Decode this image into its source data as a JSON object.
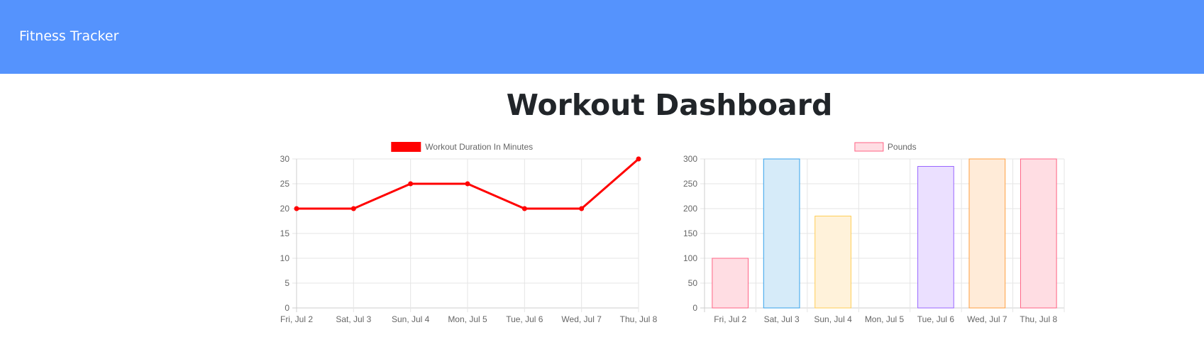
{
  "navbar": {
    "brand": "Fitness Tracker"
  },
  "page": {
    "title": "Workout Dashboard"
  },
  "chart_data": [
    {
      "type": "line",
      "categories": [
        "Fri, Jul 2",
        "Sat, Jul 3",
        "Sun, Jul 4",
        "Mon, Jul 5",
        "Tue, Jul 6",
        "Wed, Jul 7",
        "Thu, Jul 8"
      ],
      "series": [
        {
          "name": "Workout Duration In Minutes",
          "values": [
            20,
            20,
            25,
            25,
            20,
            20,
            30
          ],
          "color": "#ff0000"
        }
      ],
      "yticks": [
        0,
        5,
        10,
        15,
        20,
        25,
        30
      ],
      "ylim": [
        0,
        30
      ],
      "grid": true,
      "legend": "top-center"
    },
    {
      "type": "bar",
      "categories": [
        "Fri, Jul 2",
        "Sat, Jul 3",
        "Sun, Jul 4",
        "Mon, Jul 5",
        "Tue, Jul 6",
        "Wed, Jul 7",
        "Thu, Jul 8"
      ],
      "series": [
        {
          "name": "Pounds",
          "values": [
            100,
            300,
            185,
            0,
            285,
            300,
            300
          ]
        }
      ],
      "bar_fills": [
        "#ffdde3",
        "#d6ebf9",
        "#fff2da",
        "#e0f2f2",
        "#ebe0ff",
        "#ffebd8",
        "#ffdde3"
      ],
      "bar_strokes": [
        "#ff6384",
        "#36a2eb",
        "#ffce56",
        "#4bc0c0",
        "#9966ff",
        "#ff9f40",
        "#ff6384"
      ],
      "legend_fill": "#ffdde3",
      "legend_stroke": "#ff6384",
      "yticks": [
        0,
        50,
        100,
        150,
        200,
        250,
        300
      ],
      "ylim": [
        0,
        300
      ],
      "grid": true,
      "legend": "top-center"
    }
  ]
}
